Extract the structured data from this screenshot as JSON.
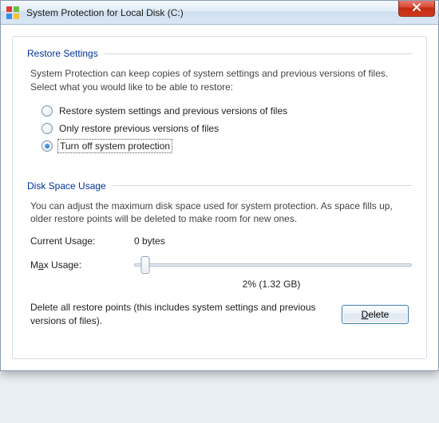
{
  "window": {
    "title": "System Protection for Local Disk (C:)"
  },
  "restore": {
    "group_title": "Restore Settings",
    "description": "System Protection can keep copies of system settings and previous versions of files. Select what you would like to be able to restore:",
    "options": [
      {
        "label": "Restore system settings and previous versions of files",
        "checked": false
      },
      {
        "label": "Only restore previous versions of files",
        "checked": false
      },
      {
        "label": "Turn off system protection",
        "checked": true
      }
    ],
    "selected_index": 2
  },
  "disk": {
    "group_title": "Disk Space Usage",
    "description": "You can adjust the maximum disk space used for system protection. As space fills up, older restore points will be deleted to make room for new ones.",
    "current_label": "Current Usage:",
    "current_value": "0 bytes",
    "max_label_pre": "M",
    "max_label_ul": "a",
    "max_label_post": "x Usage:",
    "slider_percent": 2,
    "slider_display": "2% (1.32 GB)"
  },
  "delete": {
    "text": "Delete all restore points (this includes system settings and previous versions of files).",
    "button_ul": "D",
    "button_rest": "elete"
  },
  "icons": {
    "app": "windows-flag-icon",
    "close": "close-icon"
  }
}
